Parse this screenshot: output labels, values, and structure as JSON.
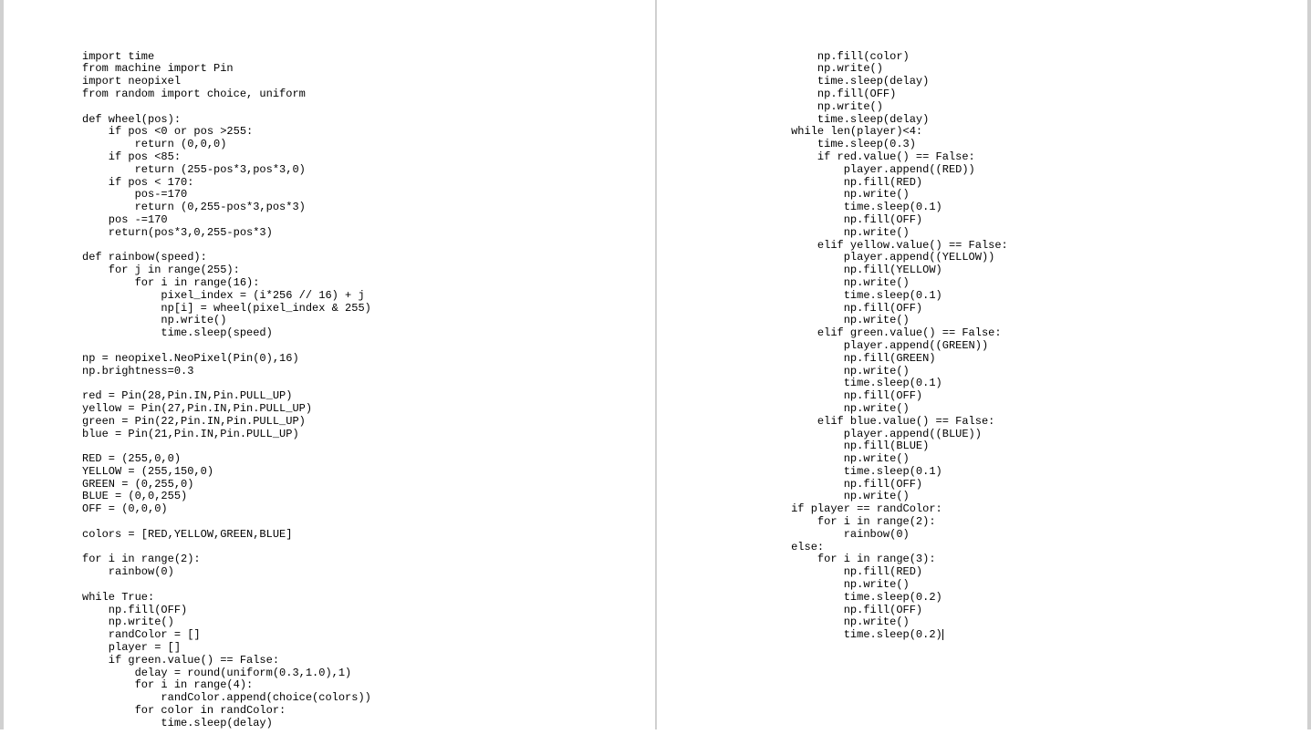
{
  "left_column": {
    "lines": [
      "import time",
      "from machine import Pin",
      "import neopixel",
      "from random import choice, uniform",
      "",
      "def wheel(pos):",
      "    if pos <0 or pos >255:",
      "        return (0,0,0)",
      "    if pos <85:",
      "        return (255-pos*3,pos*3,0)",
      "    if pos < 170:",
      "        pos-=170",
      "        return (0,255-pos*3,pos*3)",
      "    pos -=170",
      "    return(pos*3,0,255-pos*3)",
      "",
      "def rainbow(speed):",
      "    for j in range(255):",
      "        for i in range(16):",
      "            pixel_index = (i*256 // 16) + j",
      "            np[i] = wheel(pixel_index & 255)",
      "            np.write()",
      "            time.sleep(speed)",
      "",
      "np = neopixel.NeoPixel(Pin(0),16)",
      "np.brightness=0.3",
      "",
      "red = Pin(28,Pin.IN,Pin.PULL_UP)",
      "yellow = Pin(27,Pin.IN,Pin.PULL_UP)",
      "green = Pin(22,Pin.IN,Pin.PULL_UP)",
      "blue = Pin(21,Pin.IN,Pin.PULL_UP)",
      "",
      "RED = (255,0,0)",
      "YELLOW = (255,150,0)",
      "GREEN = (0,255,0)",
      "BLUE = (0,0,255)",
      "OFF = (0,0,0)",
      "",
      "colors = [RED,YELLOW,GREEN,BLUE]",
      "",
      "for i in range(2):",
      "    rainbow(0)",
      "",
      "while True:",
      "    np.fill(OFF)",
      "    np.write()",
      "    randColor = []",
      "    player = []",
      "    if green.value() == False:",
      "        delay = round(uniform(0.3,1.0),1)",
      "        for i in range(4):",
      "            randColor.append(choice(colors))",
      "        for color in randColor:",
      "            time.sleep(delay)"
    ]
  },
  "right_column": {
    "lines": [
      "            np.fill(color)",
      "            np.write()",
      "            time.sleep(delay)",
      "            np.fill(OFF)",
      "            np.write()",
      "            time.sleep(delay)",
      "        while len(player)<4:",
      "            time.sleep(0.3)",
      "            if red.value() == False:",
      "                player.append((RED))",
      "                np.fill(RED)",
      "                np.write()",
      "                time.sleep(0.1)",
      "                np.fill(OFF)",
      "                np.write()",
      "            elif yellow.value() == False:",
      "                player.append((YELLOW))",
      "                np.fill(YELLOW)",
      "                np.write()",
      "                time.sleep(0.1)",
      "                np.fill(OFF)",
      "                np.write()",
      "            elif green.value() == False:",
      "                player.append((GREEN))",
      "                np.fill(GREEN)",
      "                np.write()",
      "                time.sleep(0.1)",
      "                np.fill(OFF)",
      "                np.write()",
      "            elif blue.value() == False:",
      "                player.append((BLUE))",
      "                np.fill(BLUE)",
      "                np.write()",
      "                time.sleep(0.1)",
      "                np.fill(OFF)",
      "                np.write()",
      "        if player == randColor:",
      "            for i in range(2):",
      "                rainbow(0)",
      "        else:",
      "            for i in range(3):",
      "                np.fill(RED)",
      "                np.write()",
      "                time.sleep(0.2)",
      "                np.fill(OFF)",
      "                np.write()",
      "                time.sleep(0.2)"
    ],
    "cursor_line_index": 46
  }
}
